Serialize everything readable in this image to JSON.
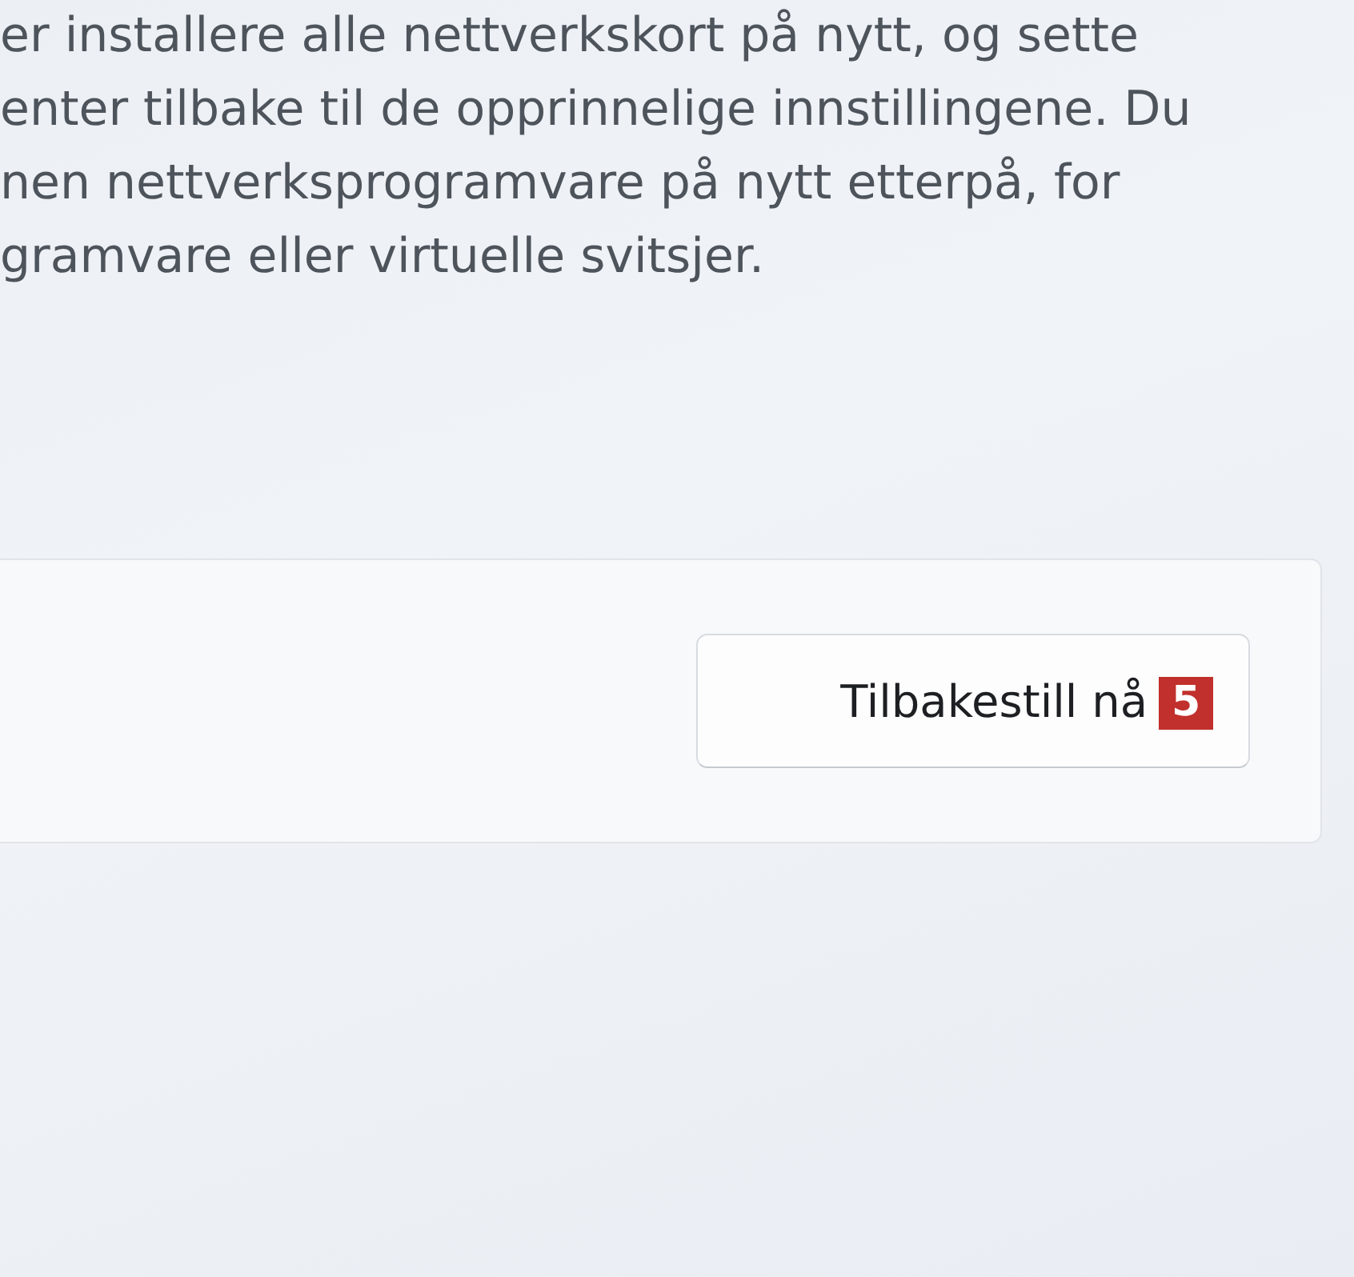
{
  "description": {
    "lines": [
      "er installere alle nettverkskort på nytt, og sette",
      "enter tilbake til de opprinnelige innstillingene. Du",
      "nen nettverksprogramvare på nytt etterpå, for",
      "gramvare eller virtuelle svitsjer."
    ]
  },
  "reset_card": {
    "button": "Tilbakestill nå",
    "badge": "5"
  }
}
